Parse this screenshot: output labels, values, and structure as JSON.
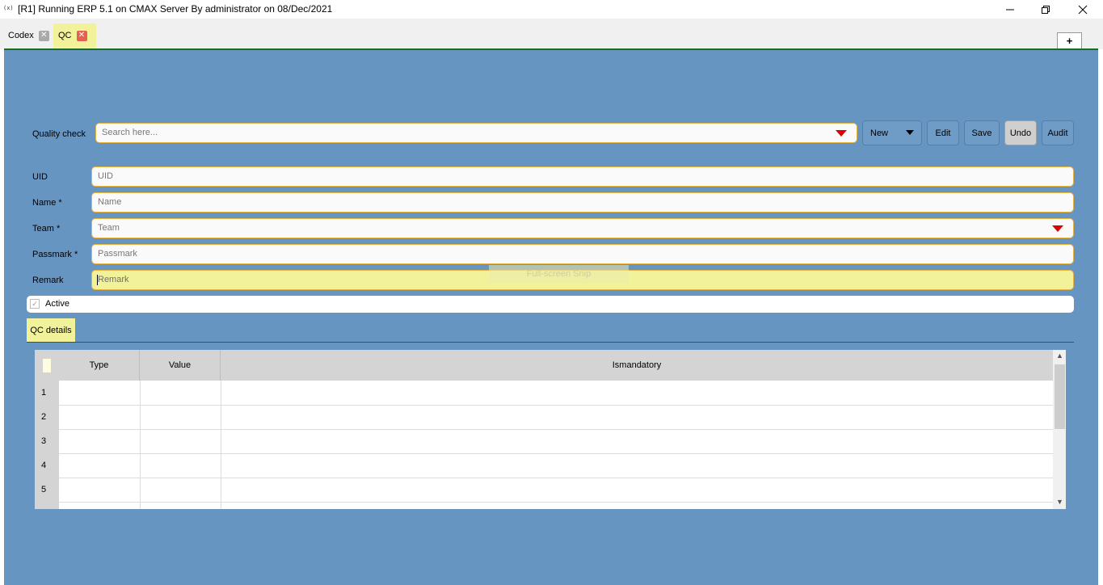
{
  "window": {
    "icon": "(x)",
    "title": "[R1] Running ERP 5.1 on CMAX Server By administrator on 08/Dec/2021"
  },
  "tabs": [
    {
      "label": "Codex",
      "active": false
    },
    {
      "label": "QC",
      "active": true
    }
  ],
  "add_tab_label": "+",
  "toolbar": {
    "search_label": "Quality check",
    "search_placeholder": "Search here...",
    "new_label": "New",
    "edit_label": "Edit",
    "save_label": "Save",
    "undo_label": "Undo",
    "audit_label": "Audit"
  },
  "form": {
    "uid": {
      "label": "UID",
      "placeholder": "UID"
    },
    "name": {
      "label": "Name *",
      "placeholder": "Name"
    },
    "team": {
      "label": "Team *",
      "placeholder": "Team"
    },
    "passmark": {
      "label": "Passmark *",
      "placeholder": "Passmark"
    },
    "remark": {
      "label": "Remark",
      "placeholder": "Remark"
    },
    "active": {
      "label": "Active",
      "checked": true
    }
  },
  "overlay_text": "Full-screen Snip",
  "details": {
    "tab_label": "QC details",
    "columns": [
      "Type",
      "Value",
      "Ismandatory"
    ],
    "rows": [
      "1",
      "2",
      "3",
      "4",
      "5"
    ]
  },
  "colors": {
    "panel": "#6795c2",
    "highlight": "#f2f29a",
    "field_border": "#e8b23c",
    "dropdown_arrow": "#dd0000",
    "accent_line": "#1d6b1d"
  }
}
